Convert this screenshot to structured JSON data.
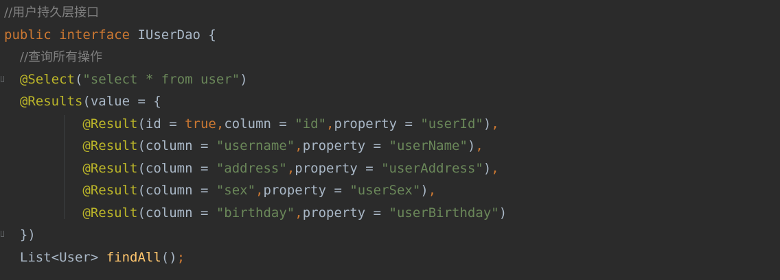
{
  "editor": {
    "lines": [
      {
        "tokens": [
          {
            "cls": "cmt",
            "text": "//用户持久层接口"
          }
        ]
      },
      {
        "tokens": [
          {
            "cls": "kw",
            "text": "public"
          },
          {
            "cls": "plain",
            "text": " "
          },
          {
            "cls": "kw",
            "text": "interface"
          },
          {
            "cls": "plain",
            "text": " IUserDao {"
          }
        ]
      },
      {
        "tokens": [
          {
            "cls": "plain",
            "text": "  "
          },
          {
            "cls": "cmt",
            "text": "//查询所有操作"
          }
        ]
      },
      {
        "tokens": [
          {
            "cls": "plain",
            "text": "  "
          },
          {
            "cls": "ann",
            "text": "@Select"
          },
          {
            "cls": "plain",
            "text": "("
          },
          {
            "cls": "str",
            "text": "\"select * from user\""
          },
          {
            "cls": "plain",
            "text": ")"
          }
        ]
      },
      {
        "tokens": [
          {
            "cls": "plain",
            "text": "  "
          },
          {
            "cls": "ann",
            "text": "@Results"
          },
          {
            "cls": "plain",
            "text": "(value = {"
          }
        ]
      },
      {
        "tokens": [
          {
            "cls": "plain",
            "text": "          "
          },
          {
            "cls": "ann",
            "text": "@Result"
          },
          {
            "cls": "plain",
            "text": "(id = "
          },
          {
            "cls": "kw",
            "text": "true"
          },
          {
            "cls": "kw",
            "text": ","
          },
          {
            "cls": "plain",
            "text": "column = "
          },
          {
            "cls": "str",
            "text": "\"id\""
          },
          {
            "cls": "kw",
            "text": ","
          },
          {
            "cls": "plain",
            "text": "property = "
          },
          {
            "cls": "str",
            "text": "\"userId\""
          },
          {
            "cls": "plain",
            "text": ")"
          },
          {
            "cls": "kw",
            "text": ","
          }
        ]
      },
      {
        "tokens": [
          {
            "cls": "plain",
            "text": "          "
          },
          {
            "cls": "ann",
            "text": "@Result"
          },
          {
            "cls": "plain",
            "text": "(column = "
          },
          {
            "cls": "str",
            "text": "\"username\""
          },
          {
            "cls": "kw",
            "text": ","
          },
          {
            "cls": "plain",
            "text": "property = "
          },
          {
            "cls": "str",
            "text": "\"userName\""
          },
          {
            "cls": "plain",
            "text": ")"
          },
          {
            "cls": "kw",
            "text": ","
          }
        ]
      },
      {
        "tokens": [
          {
            "cls": "plain",
            "text": "          "
          },
          {
            "cls": "ann",
            "text": "@Result"
          },
          {
            "cls": "plain",
            "text": "(column = "
          },
          {
            "cls": "str",
            "text": "\"address\""
          },
          {
            "cls": "kw",
            "text": ","
          },
          {
            "cls": "plain",
            "text": "property = "
          },
          {
            "cls": "str",
            "text": "\"userAddress\""
          },
          {
            "cls": "plain",
            "text": ")"
          },
          {
            "cls": "kw",
            "text": ","
          }
        ]
      },
      {
        "tokens": [
          {
            "cls": "plain",
            "text": "          "
          },
          {
            "cls": "ann",
            "text": "@Result"
          },
          {
            "cls": "plain",
            "text": "(column = "
          },
          {
            "cls": "str",
            "text": "\"sex\""
          },
          {
            "cls": "kw",
            "text": ","
          },
          {
            "cls": "plain",
            "text": "property = "
          },
          {
            "cls": "str",
            "text": "\"userSex\""
          },
          {
            "cls": "plain",
            "text": ")"
          },
          {
            "cls": "kw",
            "text": ","
          }
        ]
      },
      {
        "tokens": [
          {
            "cls": "plain",
            "text": "          "
          },
          {
            "cls": "ann",
            "text": "@Result"
          },
          {
            "cls": "plain",
            "text": "(column = "
          },
          {
            "cls": "str",
            "text": "\"birthday\""
          },
          {
            "cls": "kw",
            "text": ","
          },
          {
            "cls": "plain",
            "text": "property = "
          },
          {
            "cls": "str",
            "text": "\"userBirthday\""
          },
          {
            "cls": "plain",
            "text": ")"
          }
        ]
      },
      {
        "tokens": [
          {
            "cls": "plain",
            "text": "  })"
          }
        ]
      },
      {
        "tokens": [
          {
            "cls": "plain",
            "text": "  List<User> "
          },
          {
            "cls": "fn",
            "text": "findAll"
          },
          {
            "cls": "plain",
            "text": "()"
          },
          {
            "cls": "kw",
            "text": ";"
          }
        ]
      }
    ]
  },
  "theme": {
    "background": "#2b2b2b",
    "keyword": "#cc7832",
    "annotation": "#bbb529",
    "string": "#6a8759",
    "comment": "#808080",
    "method": "#ffc66d",
    "text": "#a9b7c6"
  }
}
